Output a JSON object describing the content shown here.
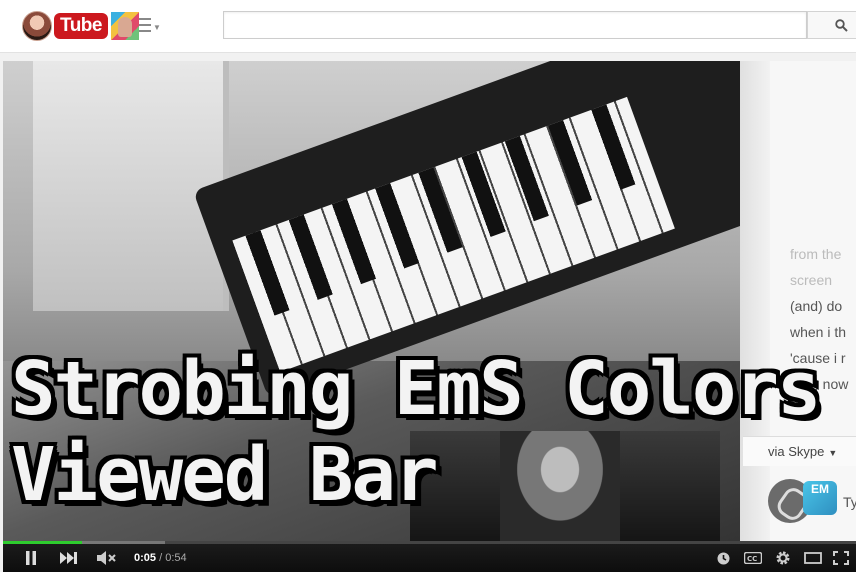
{
  "masthead": {
    "logo_text": "Tube",
    "search": {
      "value": "",
      "placeholder": ""
    }
  },
  "video": {
    "title_overlay": [
      "Strobing EmS Colors",
      "Viewed Bar"
    ],
    "chat": {
      "lines": [
        {
          "text": "from the",
          "style": "faint"
        },
        {
          "text": "screen",
          "style": "faint"
        },
        {
          "text": "(and) do",
          "style": "normal"
        },
        {
          "text": "when i th",
          "style": "normal"
        },
        {
          "text": "'cause i r",
          "style": "normal"
        },
        {
          "text": "(but) now",
          "style": "normal"
        }
      ],
      "via_label": "via Skype",
      "badge_text": "EM",
      "input_prefix": "Ty"
    }
  },
  "player": {
    "current_time": "0:05",
    "separator": " / ",
    "duration": "0:54",
    "progress_played_fraction": 0.093,
    "progress_loaded_fraction": 0.19
  },
  "colors": {
    "brand_red": "#cc181e",
    "progress_green": "#2ecc2e"
  },
  "icons": [
    "search-icon",
    "guide-menu-icon",
    "play-pause-icon",
    "next-icon",
    "mute-icon",
    "watch-later-icon",
    "captions-icon",
    "settings-icon",
    "theater-mode-icon",
    "fullscreen-icon"
  ]
}
